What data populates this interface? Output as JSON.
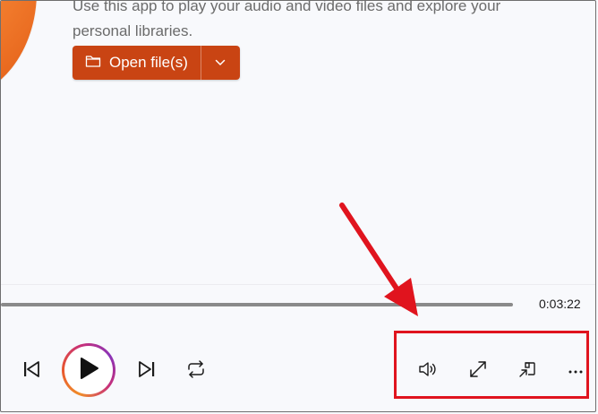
{
  "description": "Use this app to play your audio and video files and explore your personal libraries.",
  "open_button": {
    "label": "Open file(s)"
  },
  "player": {
    "duration": "0:03:22",
    "progress": 0
  },
  "colors": {
    "accent": "#c94413",
    "logo_orange": "#f0782a",
    "annotation_red": "#e0141e"
  },
  "icons": {
    "folder": "folder-icon",
    "chevron": "chevron-down-icon",
    "previous": "skip-previous-icon",
    "play": "play-icon",
    "next": "skip-next-icon",
    "repeat": "repeat-icon",
    "volume": "volume-icon",
    "fullscreen": "fullscreen-icon",
    "miniplayer": "miniplayer-icon",
    "more": "more-icon"
  }
}
